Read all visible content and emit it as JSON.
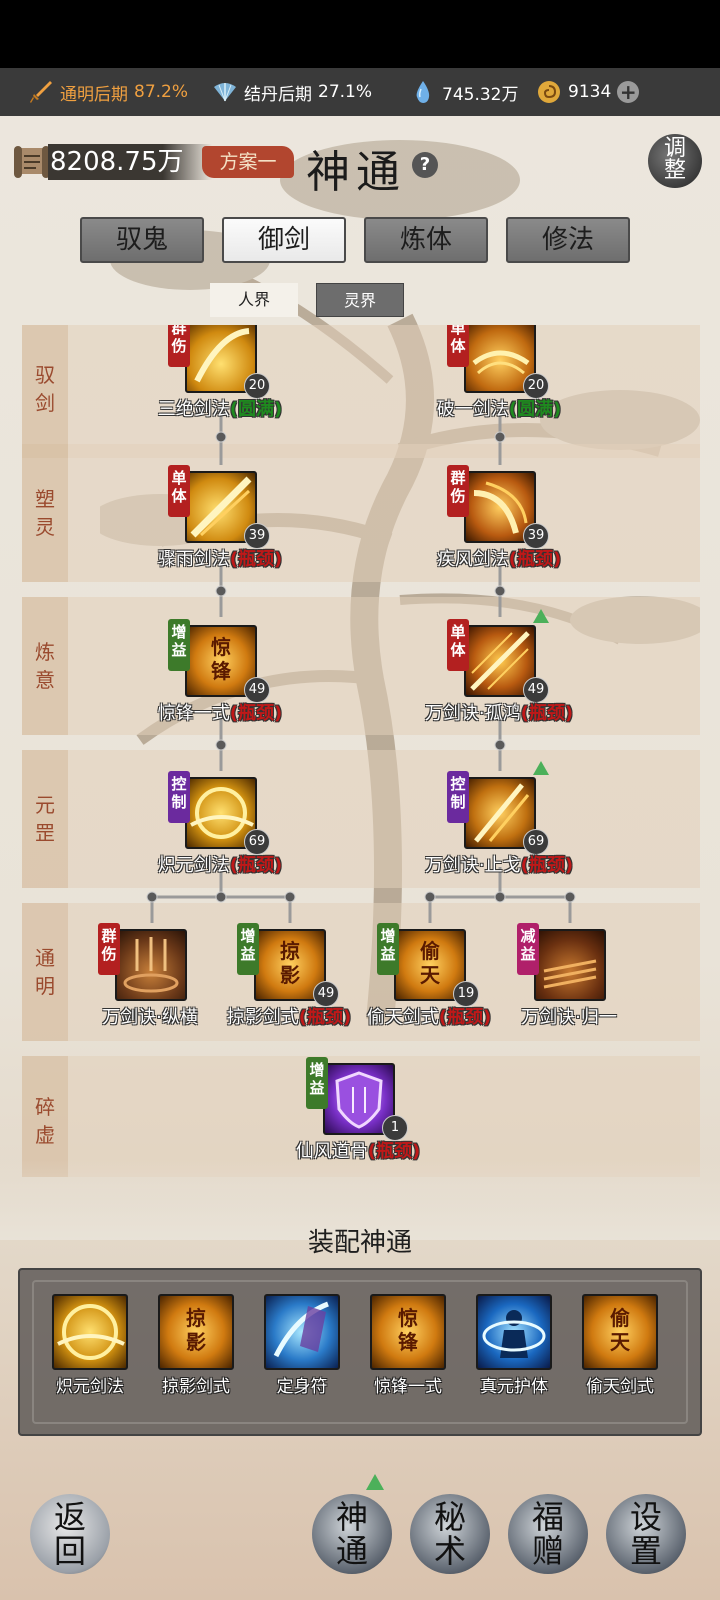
{
  "resources": {
    "realm1_label": "通明后期",
    "realm1_pct": "87.2%",
    "realm2_label": "结丹后期",
    "realm2_pct": "27.1%",
    "spirit": "745.32万",
    "currency": "9134"
  },
  "header": {
    "money": "8208.75万",
    "plan": "方案一",
    "title": "神通",
    "help": "?",
    "adjust": [
      "调",
      "整"
    ]
  },
  "tabs": [
    "驭鬼",
    "御剑",
    "炼体",
    "修法"
  ],
  "active_tab": "御剑",
  "subtabs": [
    "人界",
    "灵界"
  ],
  "active_subtab": "人界",
  "rows": [
    {
      "label": [
        "驭",
        "剑"
      ]
    },
    {
      "label": [
        "塑",
        "灵"
      ]
    },
    {
      "label": [
        "炼",
        "意"
      ]
    },
    {
      "label": [
        "元",
        "罡"
      ]
    },
    {
      "label": [
        "通",
        "明"
      ]
    },
    {
      "label": [
        "碎",
        "虚"
      ]
    }
  ],
  "nodes": [
    {
      "name": "三绝剑法",
      "status": "(圆满)",
      "level": "20",
      "tag": [
        "群",
        "伤"
      ]
    },
    {
      "name": "破一剑法",
      "status": "(圆满)",
      "level": "20",
      "tag": [
        "单",
        "体"
      ]
    },
    {
      "name": "骤雨剑法",
      "status": "(瓶颈)",
      "level": "39",
      "tag": [
        "单",
        "体"
      ]
    },
    {
      "name": "疾风剑法",
      "status": "(瓶颈)",
      "level": "39",
      "tag": [
        "群",
        "伤"
      ]
    },
    {
      "name": "惊锋一式",
      "status": "(瓶颈)",
      "level": "49",
      "tag": [
        "增",
        "益"
      ],
      "glyph": [
        "惊",
        "锋"
      ]
    },
    {
      "name": "万剑诀·孤鸿",
      "status": "(瓶颈)",
      "level": "49",
      "tag": [
        "单",
        "体"
      ]
    },
    {
      "name": "炽元剑法",
      "status": "(瓶颈)",
      "level": "69",
      "tag": [
        "控",
        "制"
      ]
    },
    {
      "name": "万剑诀·止戈",
      "status": "(瓶颈)",
      "level": "69",
      "tag": [
        "控",
        "制"
      ]
    },
    {
      "name": "万剑诀·纵横",
      "status": "",
      "level": "",
      "tag": [
        "群",
        "伤"
      ]
    },
    {
      "name": "掠影剑式",
      "status": "(瓶颈)",
      "level": "49",
      "tag": [
        "增",
        "益"
      ],
      "glyph": [
        "掠",
        "影"
      ]
    },
    {
      "name": "偷天剑式",
      "status": "(瓶颈)",
      "level": "19",
      "tag": [
        "增",
        "益"
      ],
      "glyph": [
        "偷",
        "天"
      ]
    },
    {
      "name": "万剑诀·归一",
      "status": "",
      "level": "",
      "tag": [
        "减",
        "益"
      ]
    },
    {
      "name": "仙风道骨",
      "status": "(瓶颈)",
      "level": "1",
      "tag": [
        "增",
        "益"
      ]
    }
  ],
  "equip": {
    "title": "装配神通",
    "items": [
      {
        "name": "炽元剑法"
      },
      {
        "name": "掠影剑式",
        "glyph": [
          "掠",
          "影"
        ]
      },
      {
        "name": "定身符"
      },
      {
        "name": "惊锋一式",
        "glyph": [
          "惊",
          "锋"
        ]
      },
      {
        "name": "真元护体"
      },
      {
        "name": "偷天剑式",
        "glyph": [
          "偷",
          "天"
        ]
      }
    ]
  },
  "bottom_nav": {
    "back": [
      "返",
      "回"
    ],
    "items": [
      {
        "chars": [
          "神",
          "通"
        ]
      },
      {
        "chars": [
          "秘",
          "术"
        ]
      },
      {
        "chars": [
          "福",
          "赠"
        ]
      },
      {
        "chars": [
          "设",
          "置"
        ]
      }
    ]
  },
  "colors": {
    "status_max": "#1f8a1f",
    "status_neck": "#c01818",
    "tab_active": "#f4f4f4",
    "tab_inactive": "#7a7a7a",
    "plan_bg": "#b2462f"
  }
}
